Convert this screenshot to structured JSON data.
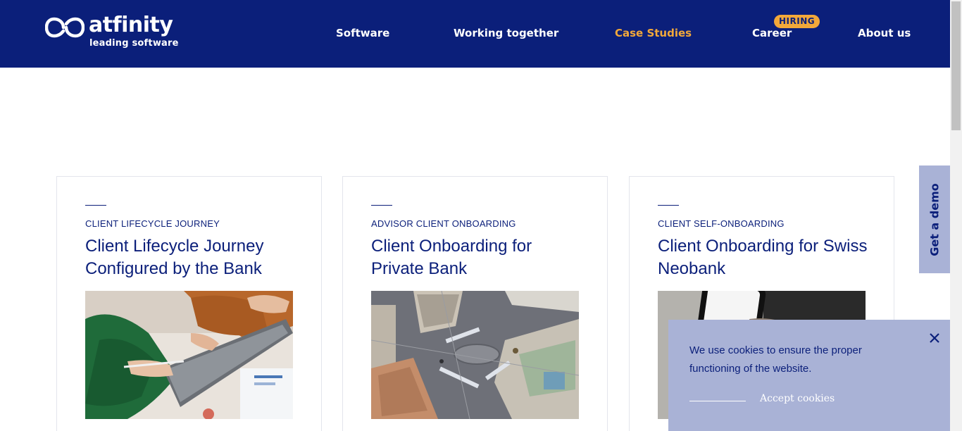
{
  "logo": {
    "name": "atfinity",
    "tagline": "leading software",
    "icon": "infinity-logo-mark"
  },
  "nav": {
    "items": [
      {
        "label": "Software",
        "active": false
      },
      {
        "label": "Working together",
        "active": false
      },
      {
        "label": "Case Studies",
        "active": true
      },
      {
        "label": "Career",
        "active": false
      },
      {
        "label": "About us",
        "active": false
      }
    ],
    "career_badge": "HIRING"
  },
  "colors": {
    "brand": "#0b1f7a",
    "accent": "#f2a83a",
    "panel": "#a9b2d6"
  },
  "cards": [
    {
      "category": "CLIENT LIFECYCLE JOURNEY",
      "title": "Client Lifecycle Journey Configured by the Bank",
      "image": "photo-people-with-tablet"
    },
    {
      "category": "ADVISOR CLIENT ONBOARDING",
      "title": "Client Onboarding for Private Bank",
      "image": "photo-aerial-city-square"
    },
    {
      "category": "CLIENT SELF-ONBOARDING",
      "title": "Client Onboarding for Swiss Neobank",
      "image": "photo-smartphone-in-hand"
    }
  ],
  "demo_tab": {
    "label": "Get a demo"
  },
  "cookie_banner": {
    "text": "We use cookies to ensure the proper functioning of the website.",
    "accept_label": "Accept cookies",
    "close_icon": "close-icon"
  }
}
